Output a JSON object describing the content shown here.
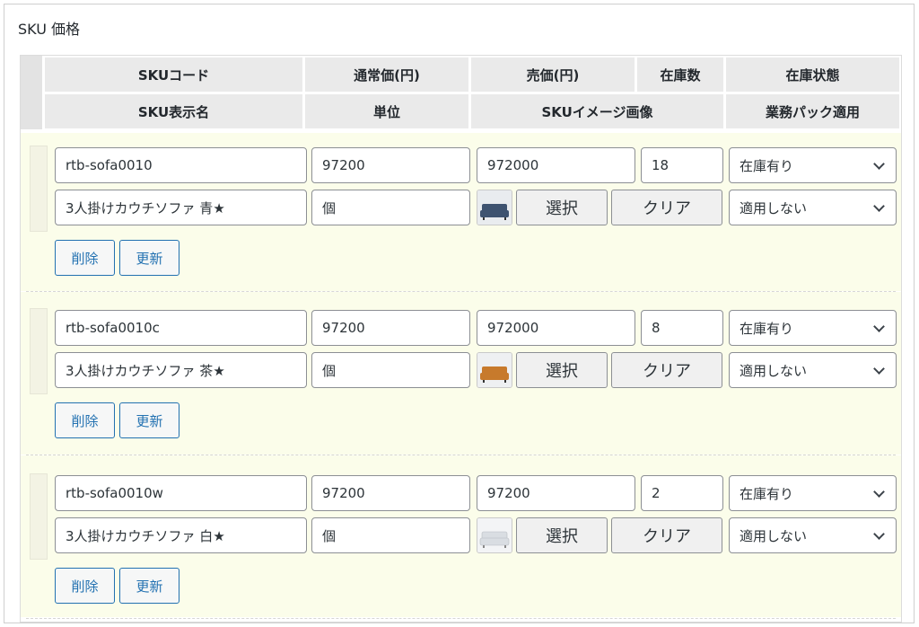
{
  "panel": {
    "title": "SKU 価格"
  },
  "header": {
    "row1": [
      "SKUコード",
      "通常価(円)",
      "売価(円)",
      "在庫数",
      "在庫状態"
    ],
    "row2": [
      "SKU表示名",
      "単位",
      "SKUイメージ画像",
      "業務パック適用"
    ]
  },
  "skus": [
    {
      "code": "rtb-sofa0010",
      "name": "3人掛けカウチソファ 青★",
      "regular_price": "97200",
      "sale_price": "972000",
      "stock": "18",
      "stock_status": "在庫有り",
      "unit": "個",
      "pack": "適用しない",
      "image_color": "#3e5370",
      "select_label": "選択",
      "clear_label": "クリア",
      "delete_label": "削除",
      "update_label": "更新"
    },
    {
      "code": "rtb-sofa0010c",
      "name": "3人掛けカウチソファ 茶★",
      "regular_price": "97200",
      "sale_price": "972000",
      "stock": "8",
      "stock_status": "在庫有り",
      "unit": "個",
      "pack": "適用しない",
      "image_color": "#c77a2c",
      "select_label": "選択",
      "clear_label": "クリア",
      "delete_label": "削除",
      "update_label": "更新"
    },
    {
      "code": "rtb-sofa0010w",
      "name": "3人掛けカウチソファ 白★",
      "regular_price": "97200",
      "sale_price": "97200",
      "stock": "2",
      "stock_status": "在庫有り",
      "unit": "個",
      "pack": "適用しない",
      "image_color": "#d9dde2",
      "select_label": "選択",
      "clear_label": "クリア",
      "delete_label": "削除",
      "update_label": "更新"
    }
  ]
}
